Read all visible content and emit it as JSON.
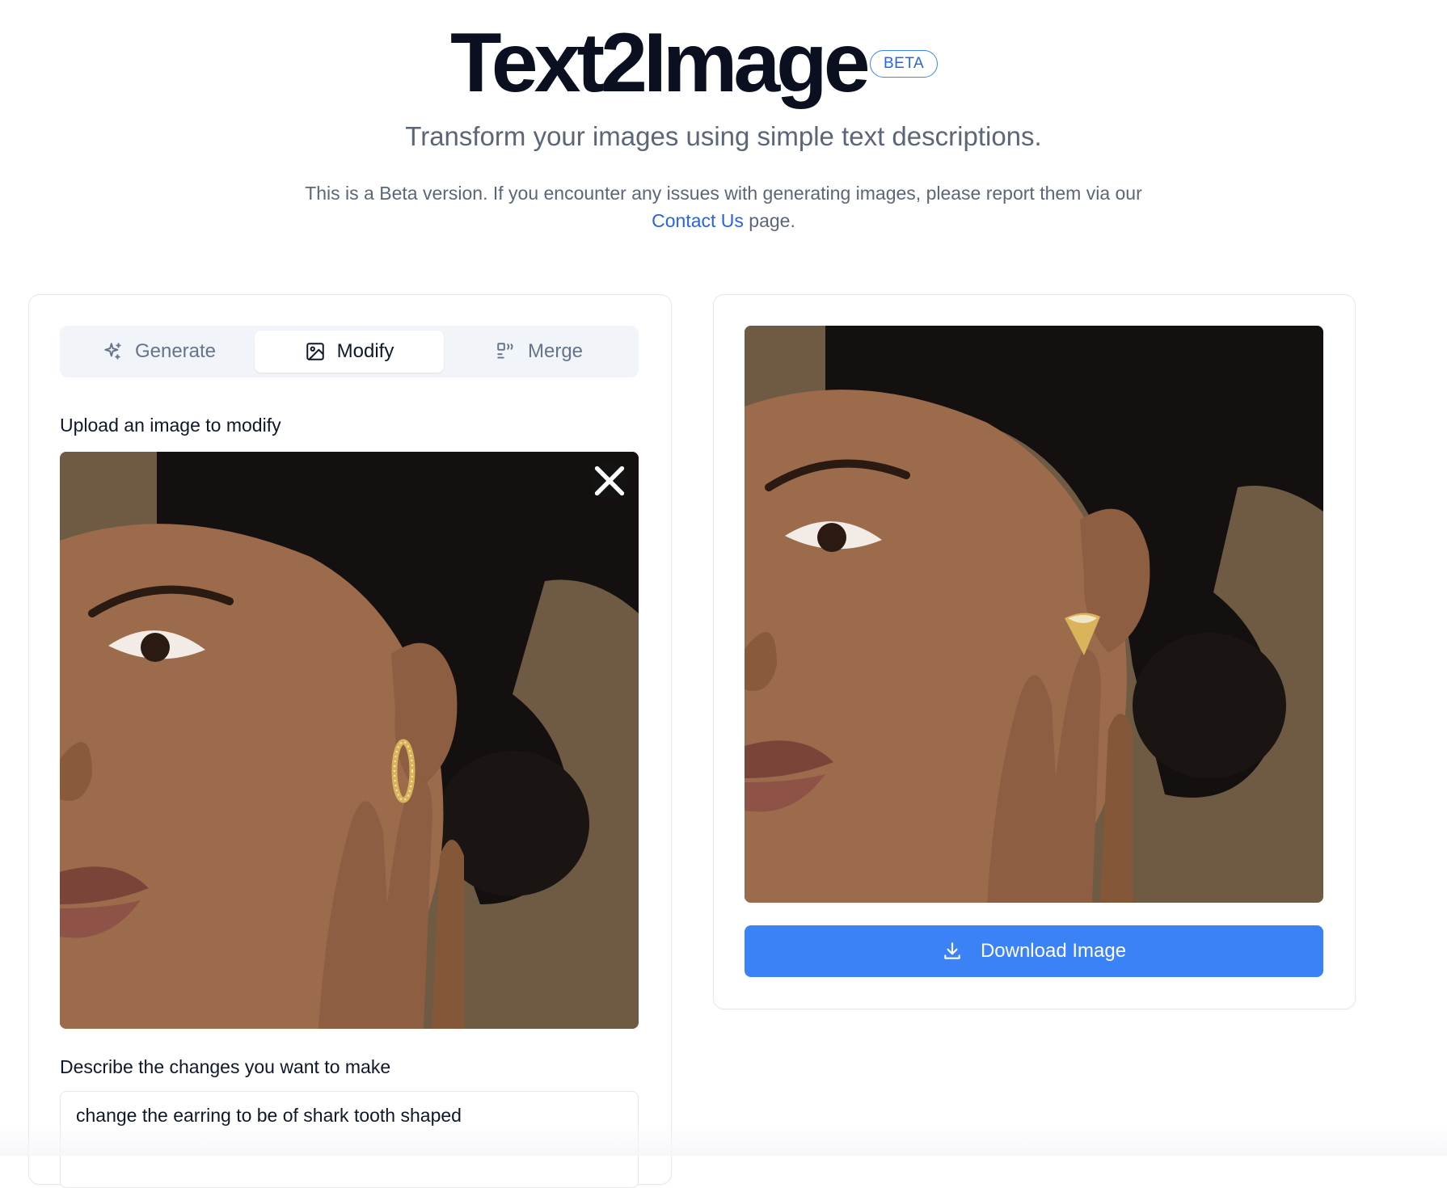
{
  "header": {
    "title": "Text2Image",
    "badge": "BETA",
    "subtitle": "Transform your images using simple text descriptions.",
    "notice_before": "This is a Beta version. If you encounter any issues with generating images, please report them via our ",
    "notice_link": "Contact Us",
    "notice_after": " page."
  },
  "tabs": [
    {
      "label": "Generate",
      "icon": "sparkles-icon",
      "active": false
    },
    {
      "label": "Modify",
      "icon": "image-icon",
      "active": true
    },
    {
      "label": "Merge",
      "icon": "merge-icon",
      "active": false
    }
  ],
  "upload": {
    "label": "Upload an image to modify",
    "image_alt": "Portrait of woman with gold hoop earring",
    "remove_icon": "close-icon"
  },
  "describe": {
    "label": "Describe the changes you want to make",
    "value": "change the earring to be of shark tooth shaped"
  },
  "result": {
    "image_alt": "Portrait of woman with shark tooth shaped gold earring",
    "download_label": "Download Image",
    "download_icon": "download-icon"
  },
  "colors": {
    "accent": "#3b82f6",
    "link": "#2563eb",
    "photo_background": "#6f5a43"
  }
}
